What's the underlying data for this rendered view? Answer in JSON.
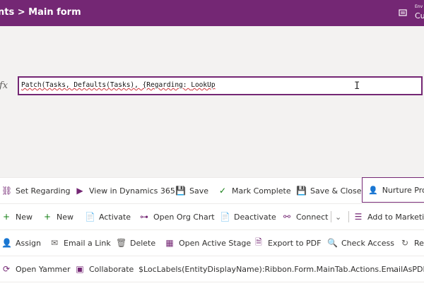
{
  "header": {
    "breadcrumb": "nts > Main form",
    "env_label": "Env",
    "env_name": "Cu"
  },
  "formula": {
    "fx_label": "fx",
    "text_part1": "Patch(Tasks, Defaults(Tasks), {Regarding: ",
    "text_part2": "LookUp"
  },
  "row1": {
    "set_regarding": "Set Regarding",
    "view_dynamics": "View in Dynamics 365",
    "save": "Save",
    "mark_complete": "Mark Complete",
    "save_close": "Save & Close",
    "nurture": "Nurture Prog"
  },
  "row2": {
    "new1": "New",
    "new2": "New",
    "activate": "Activate",
    "org_chart": "Open Org Chart",
    "deactivate": "Deactivate",
    "connect": "Connect",
    "add_marketing": "Add to Marketin"
  },
  "row3": {
    "assign": "Assign",
    "email_link": "Email a Link",
    "delete": "Delete",
    "active_stage": "Open Active Stage",
    "export_pdf": "Export to PDF",
    "check_access": "Check Access",
    "ref": "Ref"
  },
  "row4": {
    "yammer": "Open Yammer",
    "collaborate": "Collaborate",
    "loc_label": "$LocLabels(EntityDisplayName):Ribbon.Form.MainTab.Actions.EmailAsPDF"
  }
}
